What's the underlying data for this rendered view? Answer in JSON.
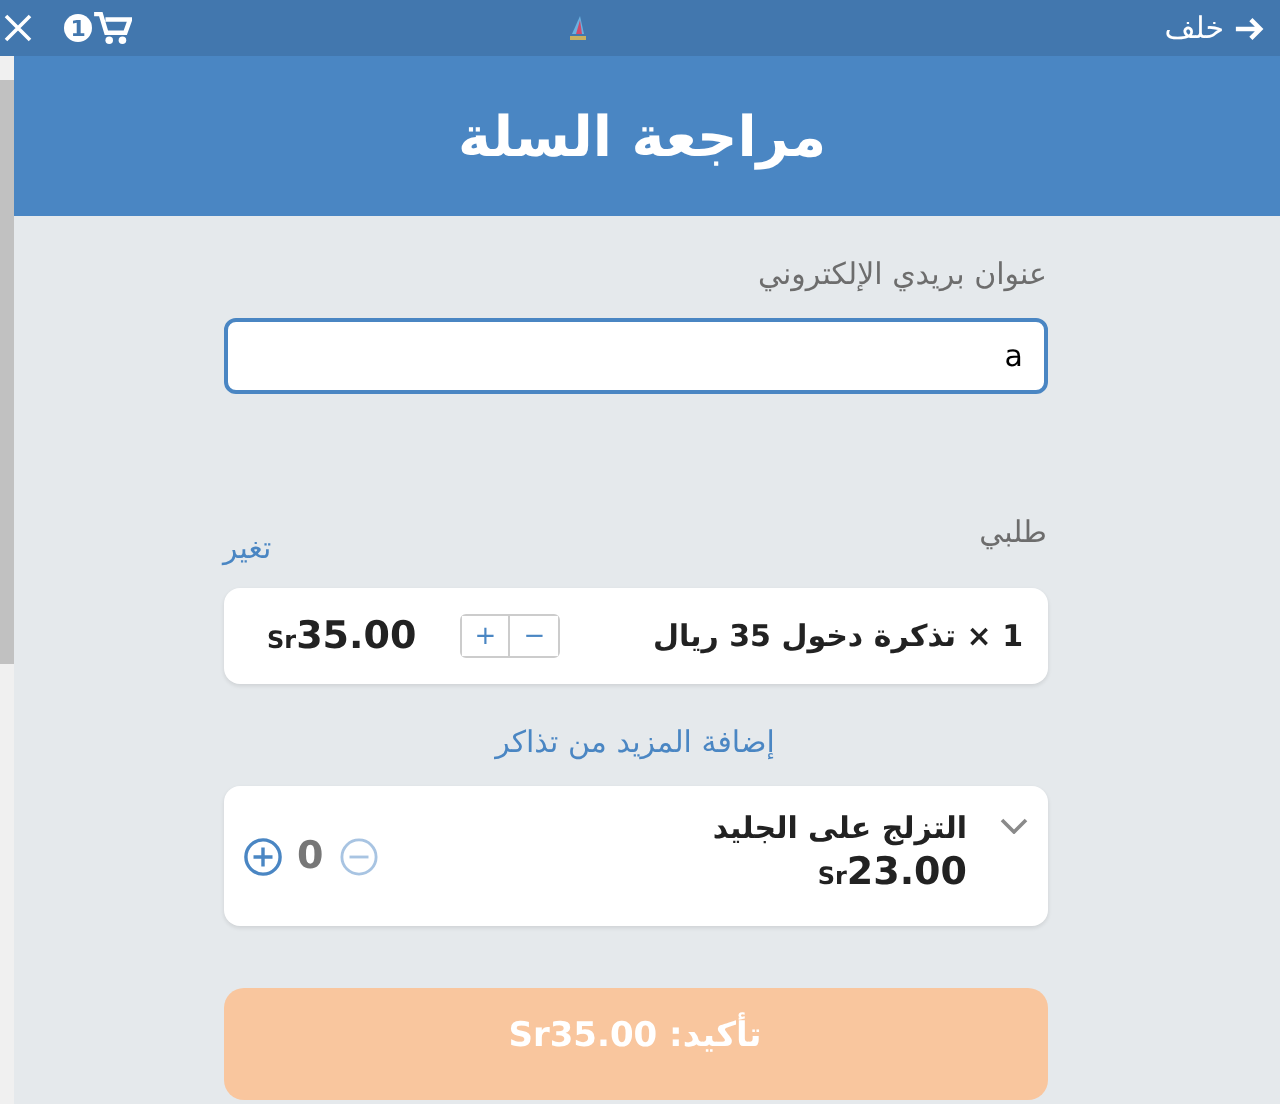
{
  "top_bar": {
    "back_label": "خلف",
    "cart_count": "1"
  },
  "header": {
    "title": "مراجعة السلة"
  },
  "email": {
    "label": "عنوان بريدي الإلكتروني",
    "value": "a"
  },
  "order": {
    "label": "طلبي",
    "change_link": "تغير"
  },
  "items": [
    {
      "kind": "ticket",
      "title": "1 × تذكرة دخول 35 ريال",
      "currency": "Sr",
      "amount": "35.00",
      "plus": "+",
      "minus": "−"
    },
    {
      "kind": "addon",
      "title": "التزلج على الجليد",
      "currency": "Sr",
      "amount": "23.00",
      "quantity": "0",
      "expanded": false,
      "minus_disabled": true
    }
  ],
  "add_more_link": "إضافة المزيد من تذاكر",
  "confirm_button": {
    "label": "تأكيد: Sr35.00"
  }
}
